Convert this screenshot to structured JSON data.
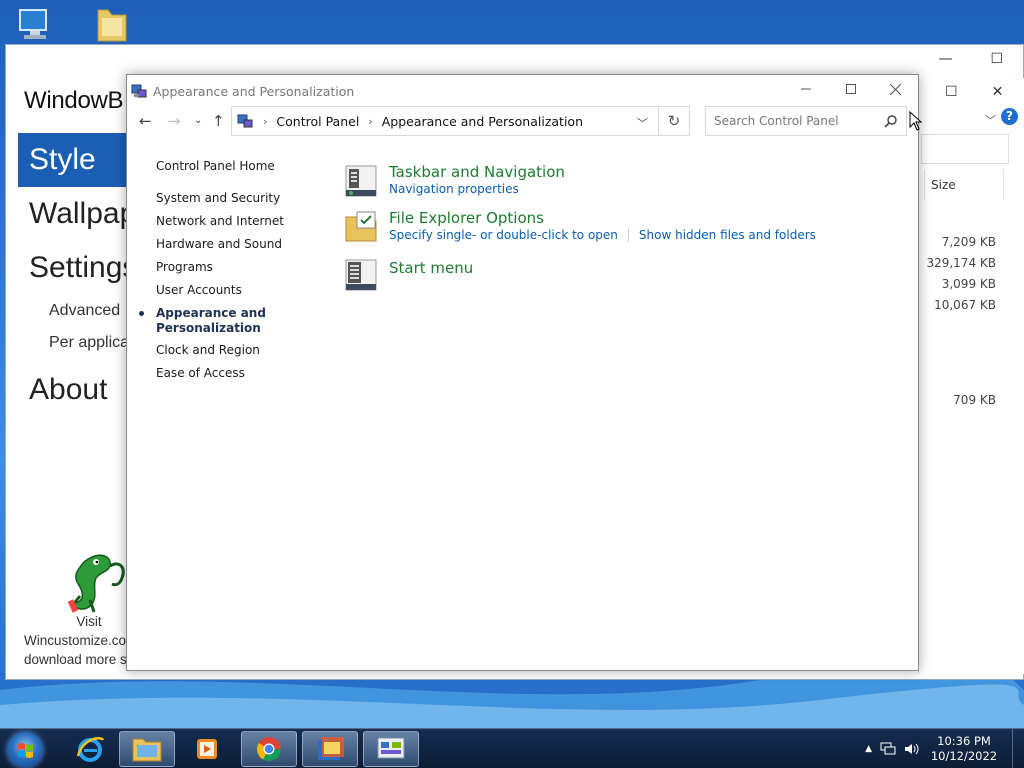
{
  "back_window": {
    "logo": "WindowB",
    "nav": [
      {
        "label": "Style",
        "active": true
      },
      {
        "label": "Wallpap"
      },
      {
        "label": "Settings"
      }
    ],
    "subnav": [
      "Advanced",
      "Per applicat"
    ],
    "about": "About",
    "visit": [
      "Visit",
      "Wincustomize.com",
      "download more s"
    ]
  },
  "explorer": {
    "size_header": "Size",
    "sizes": [
      "7,209 KB",
      "329,174 KB",
      "3,099 KB",
      "10,067 KB",
      "709 KB"
    ]
  },
  "control_panel": {
    "title": "Appearance and Personalization",
    "breadcrumb": [
      "Control Panel",
      "Appearance and Personalization"
    ],
    "search_placeholder": "Search Control Panel",
    "left_nav": {
      "home": "Control Panel Home",
      "items": [
        "System and Security",
        "Network and Internet",
        "Hardware and Sound",
        "Programs",
        "User Accounts",
        "Appearance and Personalization",
        "Clock and Region",
        "Ease of Access"
      ]
    },
    "categories": [
      {
        "title": "Taskbar and Navigation",
        "links": [
          "Navigation properties"
        ]
      },
      {
        "title": "File Explorer Options",
        "links": [
          "Specify single- or double-click to open",
          "Show hidden files and folders"
        ]
      },
      {
        "title": "Start menu",
        "links": []
      }
    ]
  },
  "taskbar": {
    "time": "10:36 PM",
    "date": "10/12/2022"
  },
  "colors": {
    "accent": "#1b5fb5",
    "category_title": "#1e7a31",
    "link": "#0a5dac"
  }
}
